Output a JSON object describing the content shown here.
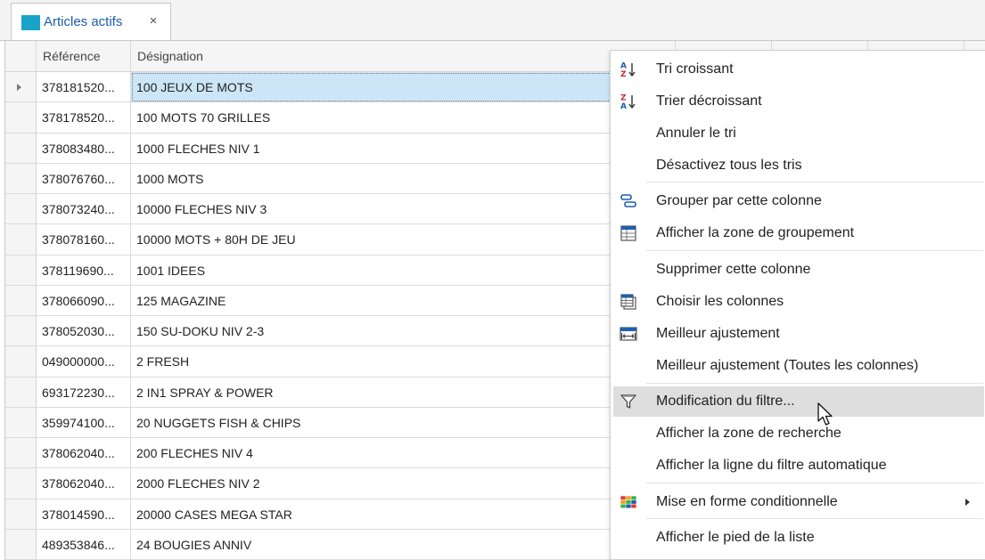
{
  "tab": {
    "label": "Articles actifs",
    "close_glyph": "×",
    "icon": "table-icon",
    "icon_color": "#1aa3c8"
  },
  "grid": {
    "columns": [
      "Référence",
      "Désignation"
    ],
    "selected_row": 0,
    "selection_color": "#cde6f7",
    "rows": [
      [
        "378181520...",
        "100 JEUX DE MOTS"
      ],
      [
        "378178520...",
        "100 MOTS  70 GRILLES"
      ],
      [
        "378083480...",
        "1000 FLECHES NIV 1"
      ],
      [
        "378076760...",
        "1000 MOTS"
      ],
      [
        "378073240...",
        "10000 FLECHES NIV 3"
      ],
      [
        "378078160...",
        "10000 MOTS + 80H DE JEU"
      ],
      [
        "378119690...",
        "1001 IDEES"
      ],
      [
        "378066090...",
        "125 MAGAZINE"
      ],
      [
        "378052030...",
        "150 SU-DOKU NIV 2-3"
      ],
      [
        "049000000...",
        "2 FRESH"
      ],
      [
        "693172230...",
        "2 IN1 SPRAY & POWER"
      ],
      [
        "359974100...",
        "20 NUGGETS FISH & CHIPS"
      ],
      [
        "378062040...",
        "200 FLECHES NIV 4"
      ],
      [
        "378062040...",
        "2000 FLECHES NIV 2"
      ],
      [
        "378014590...",
        "20000 CASES MEGA STAR"
      ],
      [
        "489353846...",
        "24 BOUGIES ANNIV"
      ]
    ]
  },
  "context_menu": {
    "hover_color": "#dedede",
    "items": [
      {
        "label": "Tri croissant",
        "icon": "sort-ascending-icon"
      },
      {
        "label": "Trier décroissant",
        "icon": "sort-descending-icon"
      },
      {
        "label": "Annuler le tri",
        "icon": ""
      },
      {
        "label": "Désactivez tous les tris",
        "icon": ""
      },
      {
        "label": "Grouper par cette colonne",
        "icon": "group-by-column-icon"
      },
      {
        "label": "Afficher la zone de groupement",
        "icon": "group-panel-icon"
      },
      {
        "label": "Supprimer cette colonne",
        "icon": ""
      },
      {
        "label": "Choisir les colonnes",
        "icon": "column-chooser-icon"
      },
      {
        "label": "Meilleur ajustement",
        "icon": "best-fit-icon"
      },
      {
        "label": "Meilleur ajustement (Toutes les colonnes)",
        "icon": ""
      },
      {
        "label": "Modification du filtre...",
        "icon": "filter-funnel-icon",
        "hover": true
      },
      {
        "label": "Afficher la zone de recherche",
        "icon": ""
      },
      {
        "label": "Afficher la ligne du filtre automatique",
        "icon": ""
      },
      {
        "label": "Mise en forme conditionnelle",
        "icon": "conditional-format-icon",
        "submenu": true
      },
      {
        "label": "Afficher le pied de la liste",
        "icon": ""
      }
    ]
  }
}
